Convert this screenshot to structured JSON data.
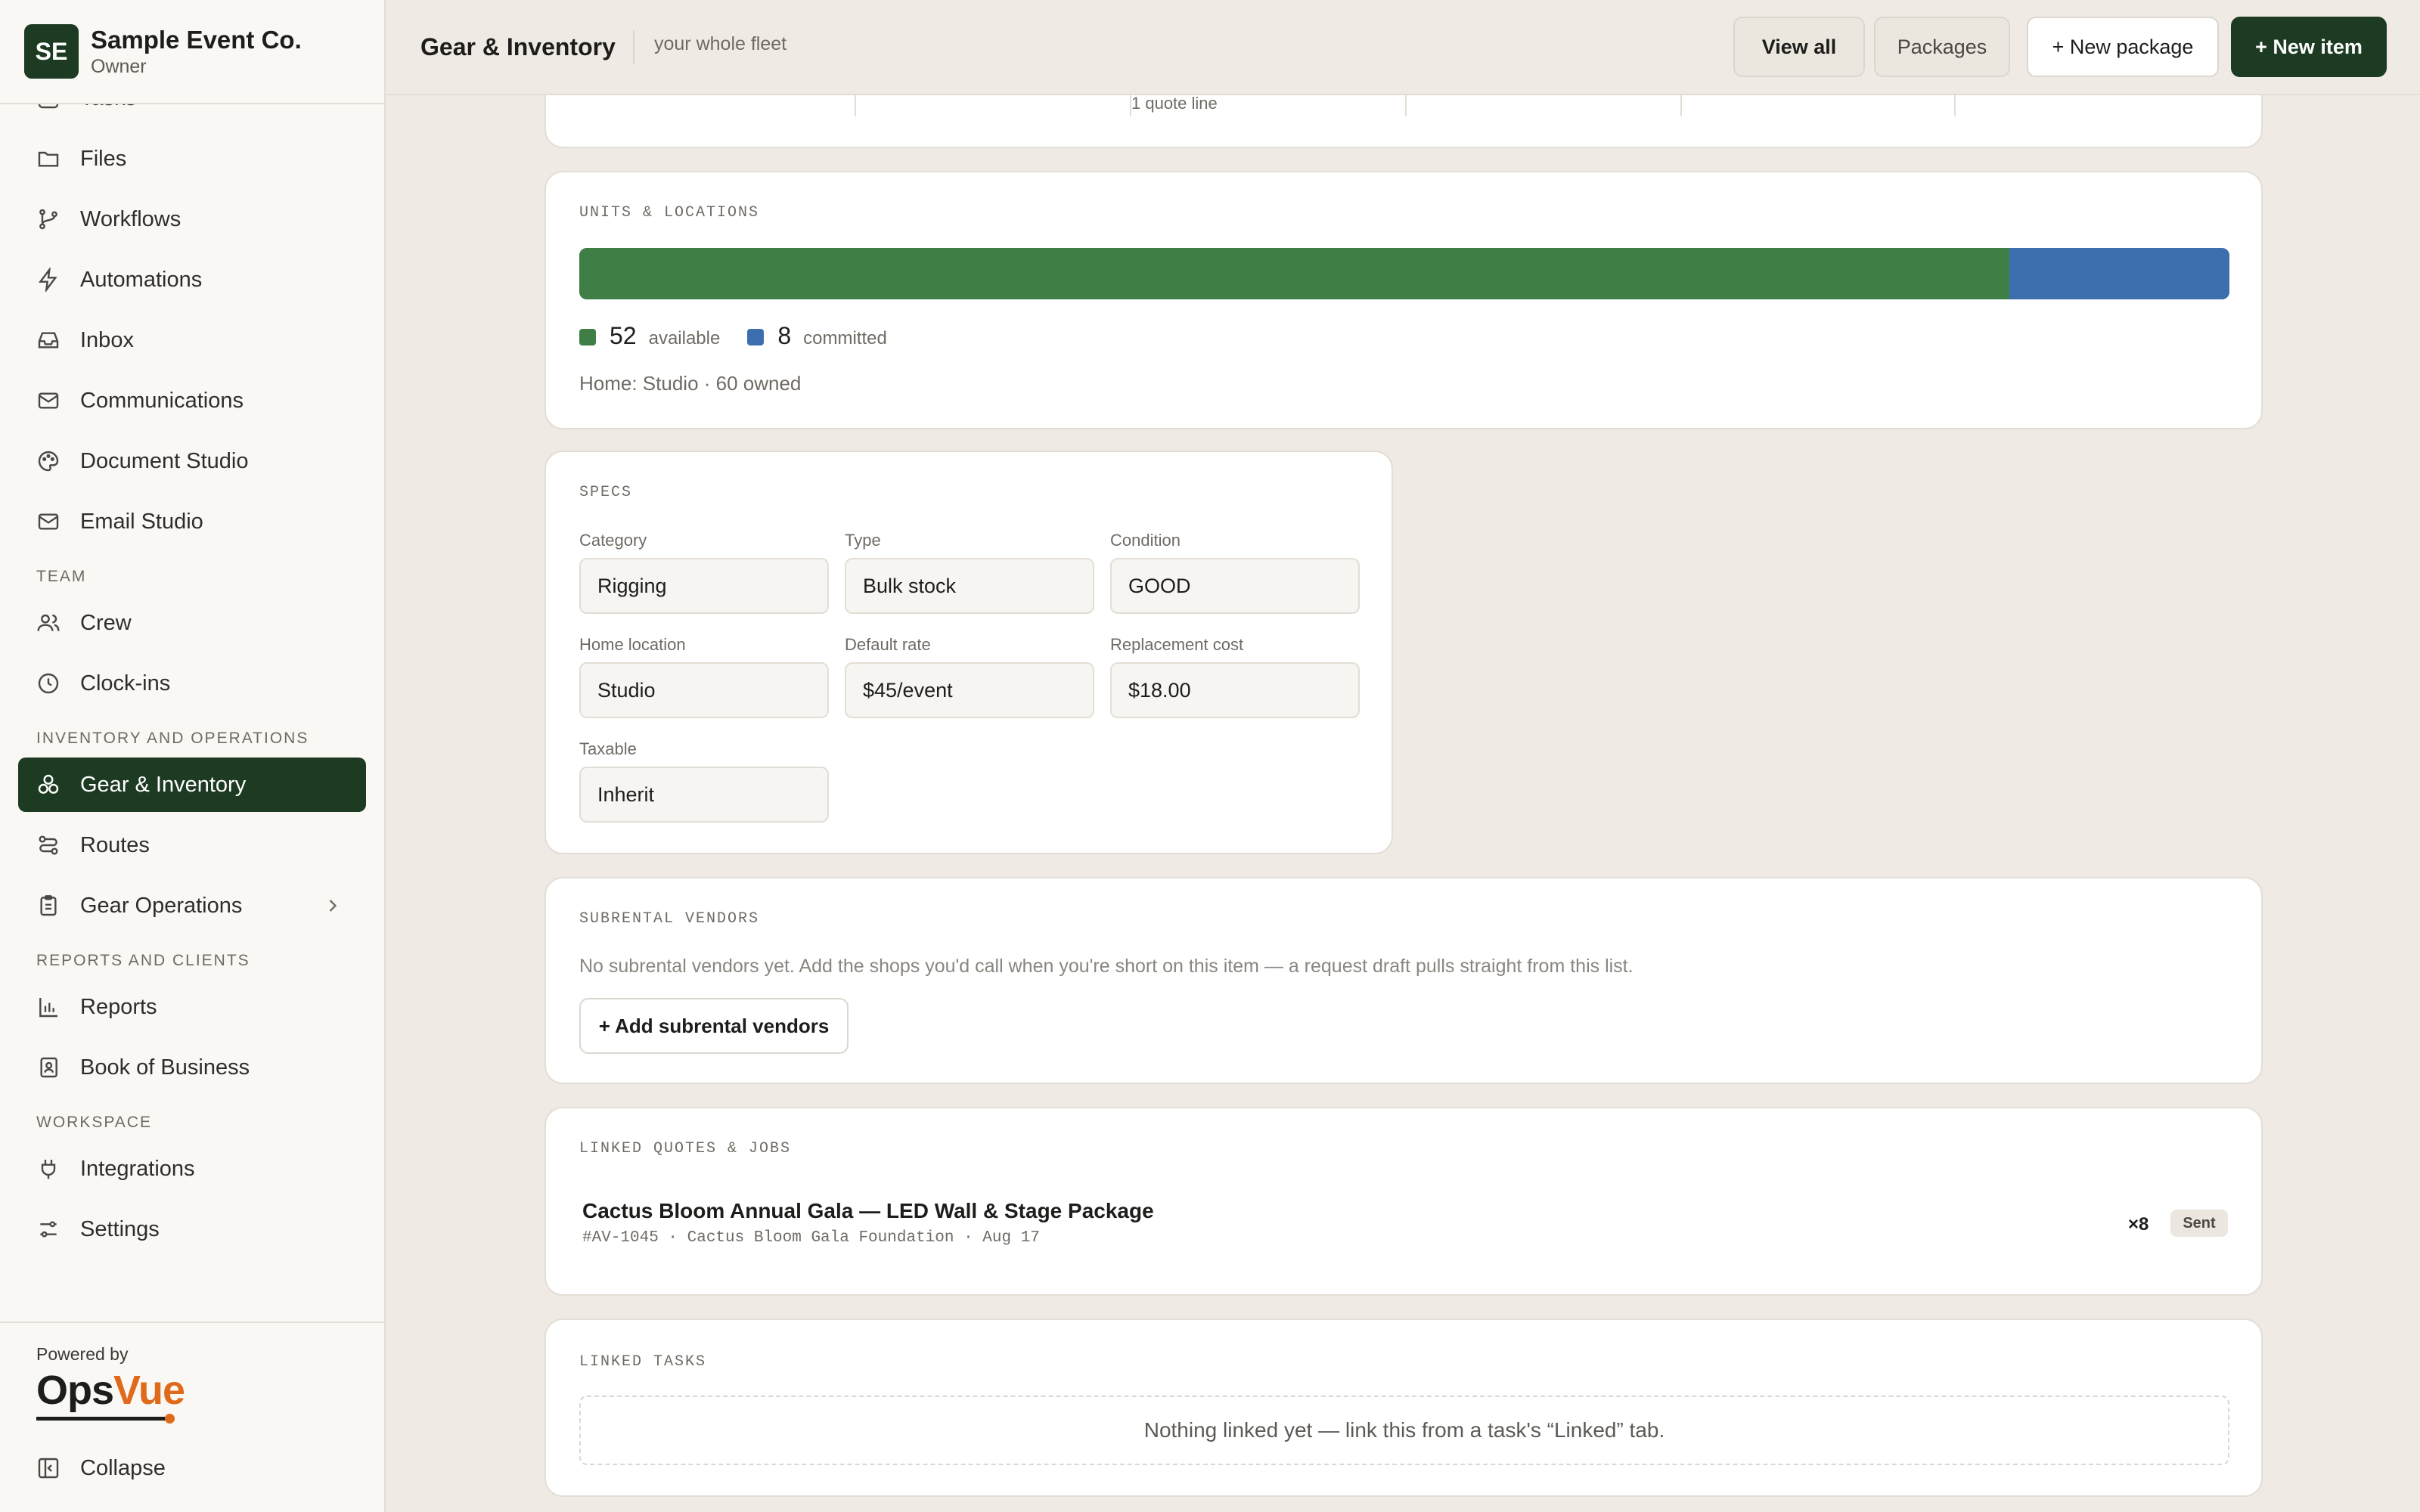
{
  "org": {
    "initials": "SE",
    "name": "Sample Event Co.",
    "role": "Owner"
  },
  "nav": {
    "partial_item": "Tasks",
    "items_top": [
      {
        "label": "Files",
        "icon": "folder-icon"
      },
      {
        "label": "Workflows",
        "icon": "git-branch-icon"
      },
      {
        "label": "Automations",
        "icon": "lightning-icon"
      },
      {
        "label": "Inbox",
        "icon": "inbox-icon"
      },
      {
        "label": "Communications",
        "icon": "mail-icon"
      },
      {
        "label": "Document Studio",
        "icon": "palette-icon"
      },
      {
        "label": "Email Studio",
        "icon": "mail-icon"
      }
    ],
    "sections": {
      "team": "TEAM",
      "inventory": "INVENTORY AND OPERATIONS",
      "reports": "REPORTS AND CLIENTS",
      "workspace": "WORKSPACE"
    },
    "team_items": [
      {
        "label": "Crew",
        "icon": "users-icon"
      },
      {
        "label": "Clock-ins",
        "icon": "clock-icon"
      }
    ],
    "inventory_items": [
      {
        "label": "Gear & Inventory",
        "icon": "boxes-icon",
        "active": true
      },
      {
        "label": "Routes",
        "icon": "route-icon"
      },
      {
        "label": "Gear Operations",
        "icon": "clipboard-icon"
      }
    ],
    "reports_items": [
      {
        "label": "Reports",
        "icon": "bar-chart-icon"
      },
      {
        "label": "Book of Business",
        "icon": "contact-book-icon"
      }
    ],
    "workspace_items": [
      {
        "label": "Integrations",
        "icon": "plug-icon"
      },
      {
        "label": "Settings",
        "icon": "sliders-icon"
      }
    ],
    "powered_by": "Powered by",
    "logo_ops": "Ops",
    "logo_vue": "Vue",
    "collapse": "Collapse"
  },
  "header": {
    "title": "Gear & Inventory",
    "subtitle": "your whole fleet",
    "view_all": "View all",
    "packages": "Packages",
    "new_package": "+ New package",
    "new_item": "+ New item"
  },
  "stats": {
    "quote_line": "1 quote line"
  },
  "units": {
    "label": "UNITS & LOCATIONS",
    "available": 52,
    "committed": 8,
    "available_label": "available",
    "committed_label": "committed",
    "home": "Home: Studio · 60 owned",
    "colors": {
      "available": "#3f7f46",
      "committed": "#3d6fae"
    }
  },
  "specs": {
    "label": "SPECS",
    "fields": [
      {
        "label": "Category",
        "value": "Rigging"
      },
      {
        "label": "Type",
        "value": "Bulk stock"
      },
      {
        "label": "Condition",
        "value": "GOOD"
      },
      {
        "label": "Home location",
        "value": "Studio"
      },
      {
        "label": "Default rate",
        "value": "$45/event"
      },
      {
        "label": "Replacement cost",
        "value": "$18.00"
      },
      {
        "label": "Taxable",
        "value": "Inherit"
      }
    ]
  },
  "vendors": {
    "label": "SUBRENTAL VENDORS",
    "empty": "No subrental vendors yet. Add the shops you'd call when you're short on this item — a request draft pulls straight from this list.",
    "add_button": "+ Add subrental vendors"
  },
  "quotes": {
    "label": "LINKED QUOTES & JOBS",
    "items": [
      {
        "title": "Cactus Bloom Annual Gala — LED Wall & Stage Package",
        "meta": "#AV-1045 · Cactus Bloom Gala Foundation · Aug 17",
        "qty": "×8",
        "status": "Sent"
      }
    ]
  },
  "tasks": {
    "label": "LINKED TASKS",
    "empty": "Nothing linked yet — link this from a task's “Linked” tab."
  }
}
